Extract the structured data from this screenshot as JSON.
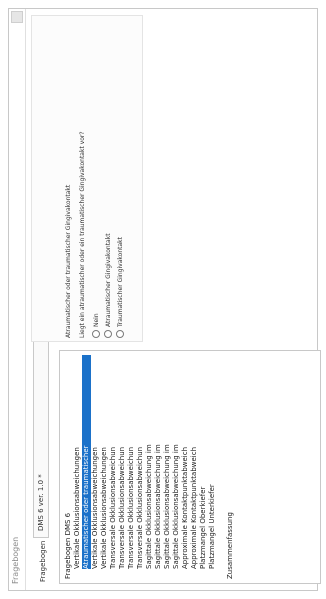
{
  "window": {
    "title": "Fragebogen"
  },
  "toolbar": {
    "questionnaire_label": "Fragebogen",
    "questionnaire_value": "DMS 6 ver. 1.0 *"
  },
  "tree": {
    "root": "Fragebogen DMS 6",
    "items": [
      "Vertikale Okklusionsabweichungen",
      "Atraumatischer oder traumatischer",
      "Vertikale Okklusionsabweichungen",
      "Vertikale Okklusionsabweichungen",
      "Transversale Okklusionsabweichun",
      "Transversale Okklusionsabweichun",
      "Transversale Okklusionsabweichun",
      "Transversale Okklusionsabweichun",
      "Sagittale Okklusionsabweichung im",
      "Sagittale Okklusionsabweichung im",
      "Sagittale Okklusionsabweichung im",
      "Sagittale Okklusionsabweichung im",
      "Approximale Kontaktpunktabweich",
      "Approximale Kontaktpunktabweich",
      "Platzmangel Oberkiefer",
      "Platzmangel Unterkiefer"
    ],
    "selected_index": 1,
    "footer": "Zusammenfassung"
  },
  "question": {
    "title": "Atraumatischer oder traumatischer Gingivakontakt",
    "text": "Liegt ein atraumatischer oder ein traumatischer Gingivakontakt vor?",
    "options": [
      "Nein",
      "Atraumatischer Gingivakontakt",
      "Traumatischer Gingivakontakt"
    ]
  }
}
